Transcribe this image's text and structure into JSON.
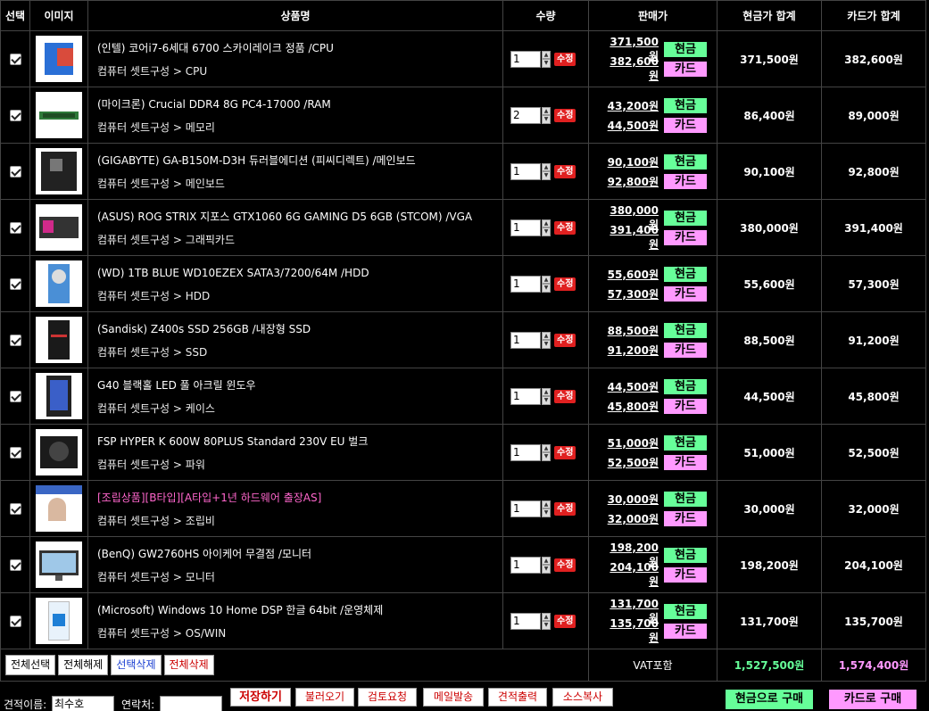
{
  "headers": {
    "select": "선택",
    "image": "이미지",
    "name": "상품명",
    "qty": "수량",
    "price": "판매가",
    "cash_total": "현금가 합계",
    "card_total": "카드가 합계"
  },
  "labels": {
    "edit": "수정",
    "cash_tag": "현금",
    "card_tag": "카드"
  },
  "items": [
    {
      "title": "(인텔) 코어i7-6세대 6700 스카이레이크 정품 /CPU",
      "category": "컴퓨터 셋트구성 > CPU",
      "qty": "1",
      "cash_price": "371,500원",
      "card_price": "382,600원",
      "cash_sum": "371,500원",
      "card_sum": "382,600원",
      "icon": "cpu-box-icon"
    },
    {
      "title": "(마이크론) Crucial DDR4 8G PC4-17000 /RAM",
      "category": "컴퓨터 셋트구성 > 메모리",
      "qty": "2",
      "cash_price": "43,200원",
      "card_price": "44,500원",
      "cash_sum": "86,400원",
      "card_sum": "89,000원",
      "icon": "ram-stick-icon"
    },
    {
      "title": "(GIGABYTE) GA-B150M-D3H 듀러블에디션 (피씨디렉트) /메인보드",
      "category": "컴퓨터 셋트구성 > 메인보드",
      "qty": "1",
      "cash_price": "90,100원",
      "card_price": "92,800원",
      "cash_sum": "90,100원",
      "card_sum": "92,800원",
      "icon": "mainboard-icon"
    },
    {
      "title": "(ASUS) ROG STRIX 지포스 GTX1060 6G GAMING D5 6GB (STCOM) /VGA",
      "category": "컴퓨터 셋트구성 > 그래픽카드",
      "qty": "1",
      "cash_price": "380,000원",
      "card_price": "391,400원",
      "cash_sum": "380,000원",
      "card_sum": "391,400원",
      "icon": "graphics-card-icon"
    },
    {
      "title": "(WD) 1TB BLUE WD10EZEX SATA3/7200/64M /HDD",
      "category": "컴퓨터 셋트구성 > HDD",
      "qty": "1",
      "cash_price": "55,600원",
      "card_price": "57,300원",
      "cash_sum": "55,600원",
      "card_sum": "57,300원",
      "icon": "hdd-icon"
    },
    {
      "title": "(Sandisk) Z400s SSD 256GB /내장형 SSD",
      "category": "컴퓨터 셋트구성 > SSD",
      "qty": "1",
      "cash_price": "88,500원",
      "card_price": "91,200원",
      "cash_sum": "88,500원",
      "card_sum": "91,200원",
      "icon": "ssd-icon"
    },
    {
      "title": "G40 블랙홀 LED 풀 아크릴 윈도우",
      "category": "컴퓨터 셋트구성 > 케이스",
      "qty": "1",
      "cash_price": "44,500원",
      "card_price": "45,800원",
      "cash_sum": "44,500원",
      "card_sum": "45,800원",
      "icon": "case-icon"
    },
    {
      "title": "FSP HYPER K 600W 80PLUS Standard 230V EU 벌크",
      "category": "컴퓨터 셋트구성 > 파워",
      "qty": "1",
      "cash_price": "51,000원",
      "card_price": "52,500원",
      "cash_sum": "51,000원",
      "card_sum": "52,500원",
      "icon": "power-supply-icon"
    },
    {
      "title": "[조립상품][B타입][A타입+1년 하드웨어 출장AS]",
      "category": "컴퓨터 셋트구성 > 조립비",
      "qty": "1",
      "cash_price": "30,000원",
      "card_price": "32,000원",
      "cash_sum": "30,000원",
      "card_sum": "32,000원",
      "icon": "assembly-service-icon",
      "highlight": true
    },
    {
      "title": "(BenQ) GW2760HS 아이케어 무결점 /모니터",
      "category": "컴퓨터 셋트구성 > 모니터",
      "qty": "1",
      "cash_price": "198,200원",
      "card_price": "204,100원",
      "cash_sum": "198,200원",
      "card_sum": "204,100원",
      "icon": "monitor-icon"
    },
    {
      "title": "(Microsoft) Windows 10 Home DSP 한글 64bit /운영체제",
      "category": "컴퓨터 셋트구성 > OS/WIN",
      "qty": "1",
      "cash_price": "131,700원",
      "card_price": "135,700원",
      "cash_sum": "131,700원",
      "card_sum": "135,700원",
      "icon": "windows-box-icon"
    }
  ],
  "footer": {
    "select_all": "전체선택",
    "deselect_all": "전체해제",
    "delete_selected": "선택삭제",
    "delete_all": "전체삭제",
    "vat": "VAT포함",
    "total_cash": "1,527,500원",
    "total_card": "1,574,400원"
  },
  "bottom": {
    "quote_name_label": "견적이름:",
    "quote_name_value": "최수호",
    "contact_label": "연락처:",
    "contact_value": "",
    "save": "저장하기",
    "load": "불러오기",
    "review": "검토요청",
    "email": "메일발송",
    "print": "견적출력",
    "copy_source": "소스복사",
    "buy_cash": "현금으로 구매",
    "buy_card": "카드로 구매"
  },
  "colors": {
    "cash": "#66ff99",
    "card": "#ff99ff",
    "edit": "#e02020",
    "highlight_title": "#ff66cc"
  }
}
